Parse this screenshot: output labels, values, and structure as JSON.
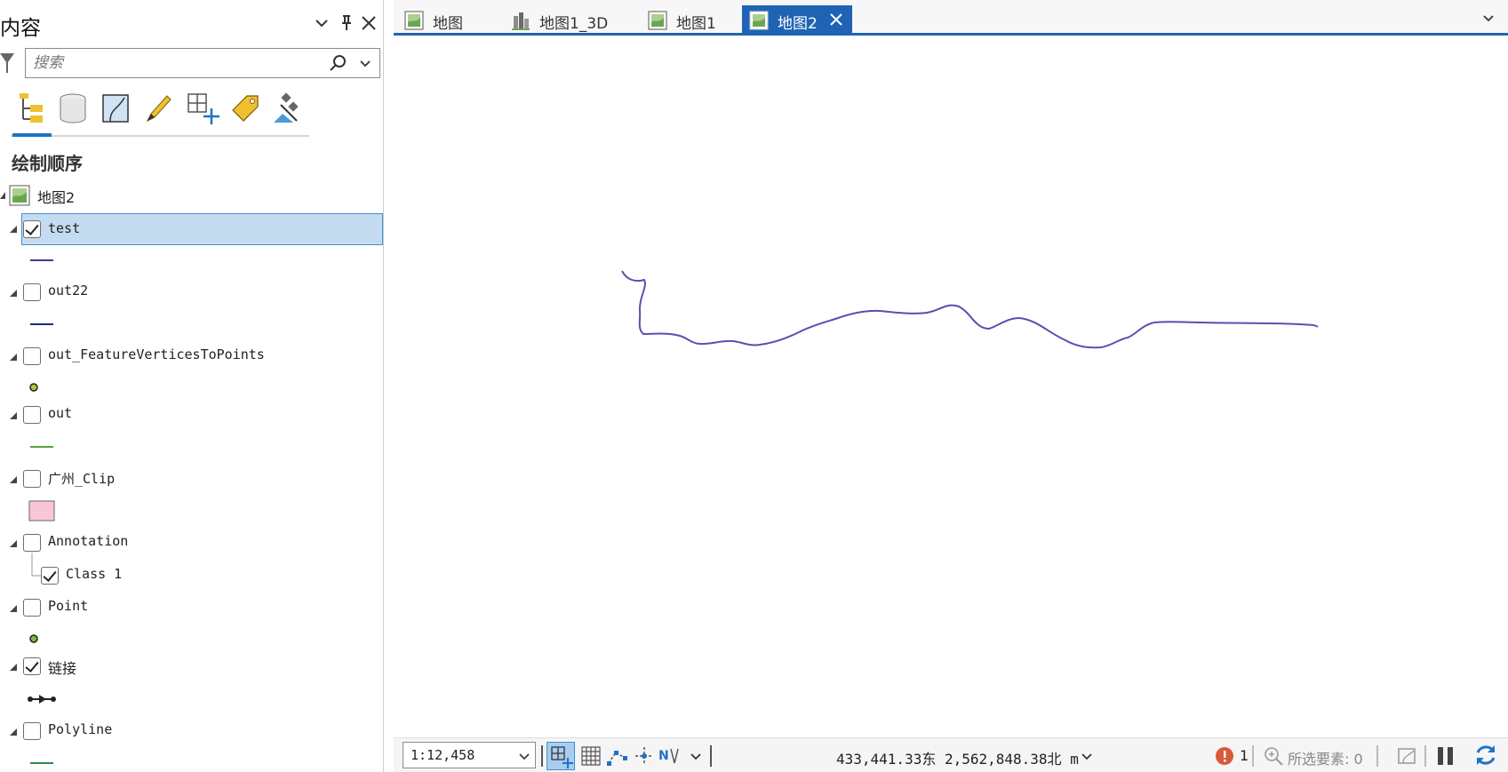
{
  "contents": {
    "title": "内容",
    "search_placeholder": "搜索",
    "section_title": "绘制顺序",
    "map_name": "地图2",
    "layers": [
      {
        "name": "test",
        "checked": true,
        "selected": true
      },
      {
        "name": "out22",
        "checked": false
      },
      {
        "name": "out_FeatureVerticesToPoints",
        "checked": false
      },
      {
        "name": "out",
        "checked": false
      },
      {
        "name": "广州_Clip",
        "checked": false
      },
      {
        "name": "Annotation",
        "checked": false
      },
      {
        "name": "Class 1",
        "checked": true
      },
      {
        "name": "Point",
        "checked": false
      },
      {
        "name": "链接",
        "checked": true
      },
      {
        "name": "Polyline",
        "checked": false
      }
    ]
  },
  "tabs": [
    {
      "label": "地图",
      "active": false
    },
    {
      "label": "地图1_3D",
      "active": false
    },
    {
      "label": "地图1",
      "active": false
    },
    {
      "label": "地图2",
      "active": true
    }
  ],
  "status": {
    "scale": "1:12,458",
    "coordinates": "433,441.33东 2,562,848.38北 m",
    "error_count": "1",
    "selected_features": "所选要素: 0"
  },
  "colors": {
    "accent": "#1f64b4",
    "selection": "#c5dcf0",
    "line_test": "#5a4fb0"
  }
}
